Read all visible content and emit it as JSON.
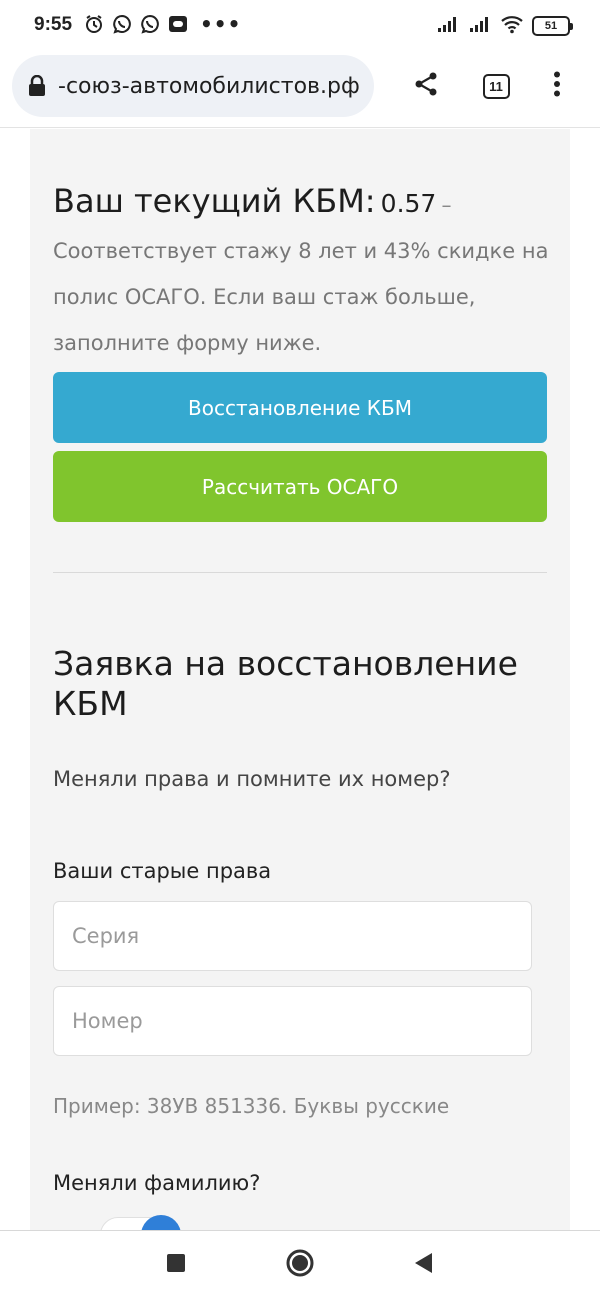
{
  "status_bar": {
    "time": "9:55",
    "battery": "51",
    "left_icons": [
      "alarm-icon",
      "viber-icon",
      "viber-icon",
      "app-notification-icon"
    ],
    "overflow": "•••"
  },
  "browser": {
    "url": "-союз-автомобилистов.рф",
    "tab_count": "11"
  },
  "kbm": {
    "title": "Ваш текущий КБМ:",
    "value": "0.57",
    "separator": "–",
    "description": "Соответствует стажу 8 лет и 43% скидке на полис ОСАГО. Если ваш стаж больше, заполните форму ниже."
  },
  "buttons": {
    "restore_label": "Восстановление КБМ",
    "calc_label": "Рассчитать ОСАГО"
  },
  "colors": {
    "restore_button": "#35a9d0",
    "calc_button": "#80c52d",
    "toggle_knob": "#2f7fd8"
  },
  "form": {
    "title": "Заявка на восстановление КБМ",
    "question": "Меняли права и помните их номер?",
    "old_license_label": "Ваши старые права",
    "series_placeholder": "Серия",
    "number_placeholder": "Номер",
    "example_hint": "Пример: 38УВ 851336. Буквы русские",
    "surname_question": "Меняли фамилию?"
  }
}
